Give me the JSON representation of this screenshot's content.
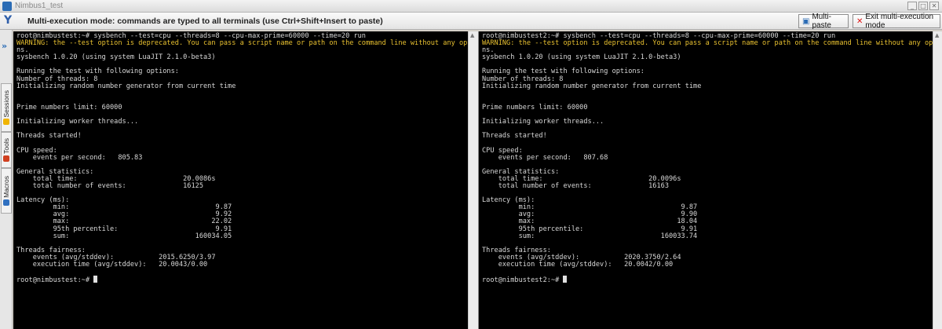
{
  "window": {
    "title": "Nimbus1_test",
    "buttons": [
      "_",
      "□",
      "✕"
    ]
  },
  "modebar": {
    "text": "Multi-execution mode: commands are typed to all terminals (use Ctrl+Shift+Insert to paste)",
    "multipaste_label": "Multi-paste",
    "exit_label": "Exit multi-execution mode"
  },
  "sidebar": {
    "tabs": [
      {
        "label": "Sessions",
        "icon": "star-icon",
        "color": "#f0b400"
      },
      {
        "label": "Tools",
        "icon": "tools-icon",
        "color": "#d04020"
      },
      {
        "label": "Macros",
        "icon": "macros-icon",
        "color": "#3070c0"
      }
    ]
  },
  "colors": {
    "terminal_bg": "#000000",
    "terminal_fg": "#d8d8d8",
    "warning": "#e8c030",
    "accent": "#2b6cb5"
  },
  "terminals": [
    {
      "prompt": "root@nimbustest:~# ",
      "command": "sysbench --test=cpu --threads=8 --cpu-max-prime=60000 --time=20 run",
      "warn1": "WARNING: the --test option is ",
      "warn_word": "deprecated",
      "warn2": ". You can pass a script name or path on the command line without any optio",
      "warn3": "ns.",
      "lines": [
        "sysbench 1.0.20 (using system LuaJIT 2.1.0-beta3)",
        "",
        "Running the test with following options:",
        "Number of threads: 8",
        "Initializing random number generator from current time",
        "",
        "",
        "Prime numbers limit: 60000",
        "",
        "Initializing worker threads...",
        "",
        "Threads started!",
        "",
        "CPU speed:",
        "    events per second:   805.83",
        "",
        "General statistics:",
        "    total time:                          20.0086s",
        "    total number of events:              16125",
        "",
        "Latency (ms):",
        "         min:                                    9.87",
        "         avg:                                    9.92",
        "         max:                                   22.02",
        "         95th percentile:                        9.91",
        "         sum:                               160034.05",
        "",
        "Threads fairness:",
        "    events (avg/stddev):           2015.6250/3.97",
        "    execution time (avg/stddev):   20.0043/0.00",
        "",
        "root@nimbustest:~# "
      ]
    },
    {
      "prompt": "root@nimbustest2:~# ",
      "command": "sysbench --test=cpu --threads=8 --cpu-max-prime=60000 --time=20 run",
      "warn1": "WARNING: the --test option is ",
      "warn_word": "deprecated",
      "warn2": ". You can pass a script name or path on the command line without any optio",
      "warn3": "ns.",
      "lines": [
        "sysbench 1.0.20 (using system LuaJIT 2.1.0-beta3)",
        "",
        "Running the test with following options:",
        "Number of threads: 8",
        "Initializing random number generator from current time",
        "",
        "",
        "Prime numbers limit: 60000",
        "",
        "Initializing worker threads...",
        "",
        "Threads started!",
        "",
        "CPU speed:",
        "    events per second:   807.68",
        "",
        "General statistics:",
        "    total time:                          20.0096s",
        "    total number of events:              16163",
        "",
        "Latency (ms):",
        "         min:                                    9.87",
        "         avg:                                    9.90",
        "         max:                                   18.04",
        "         95th percentile:                        9.91",
        "         sum:                               160033.74",
        "",
        "Threads fairness:",
        "    events (avg/stddev):           2020.3750/2.64",
        "    execution time (avg/stddev):   20.0042/0.00",
        "",
        "root@nimbustest2:~# "
      ]
    }
  ]
}
